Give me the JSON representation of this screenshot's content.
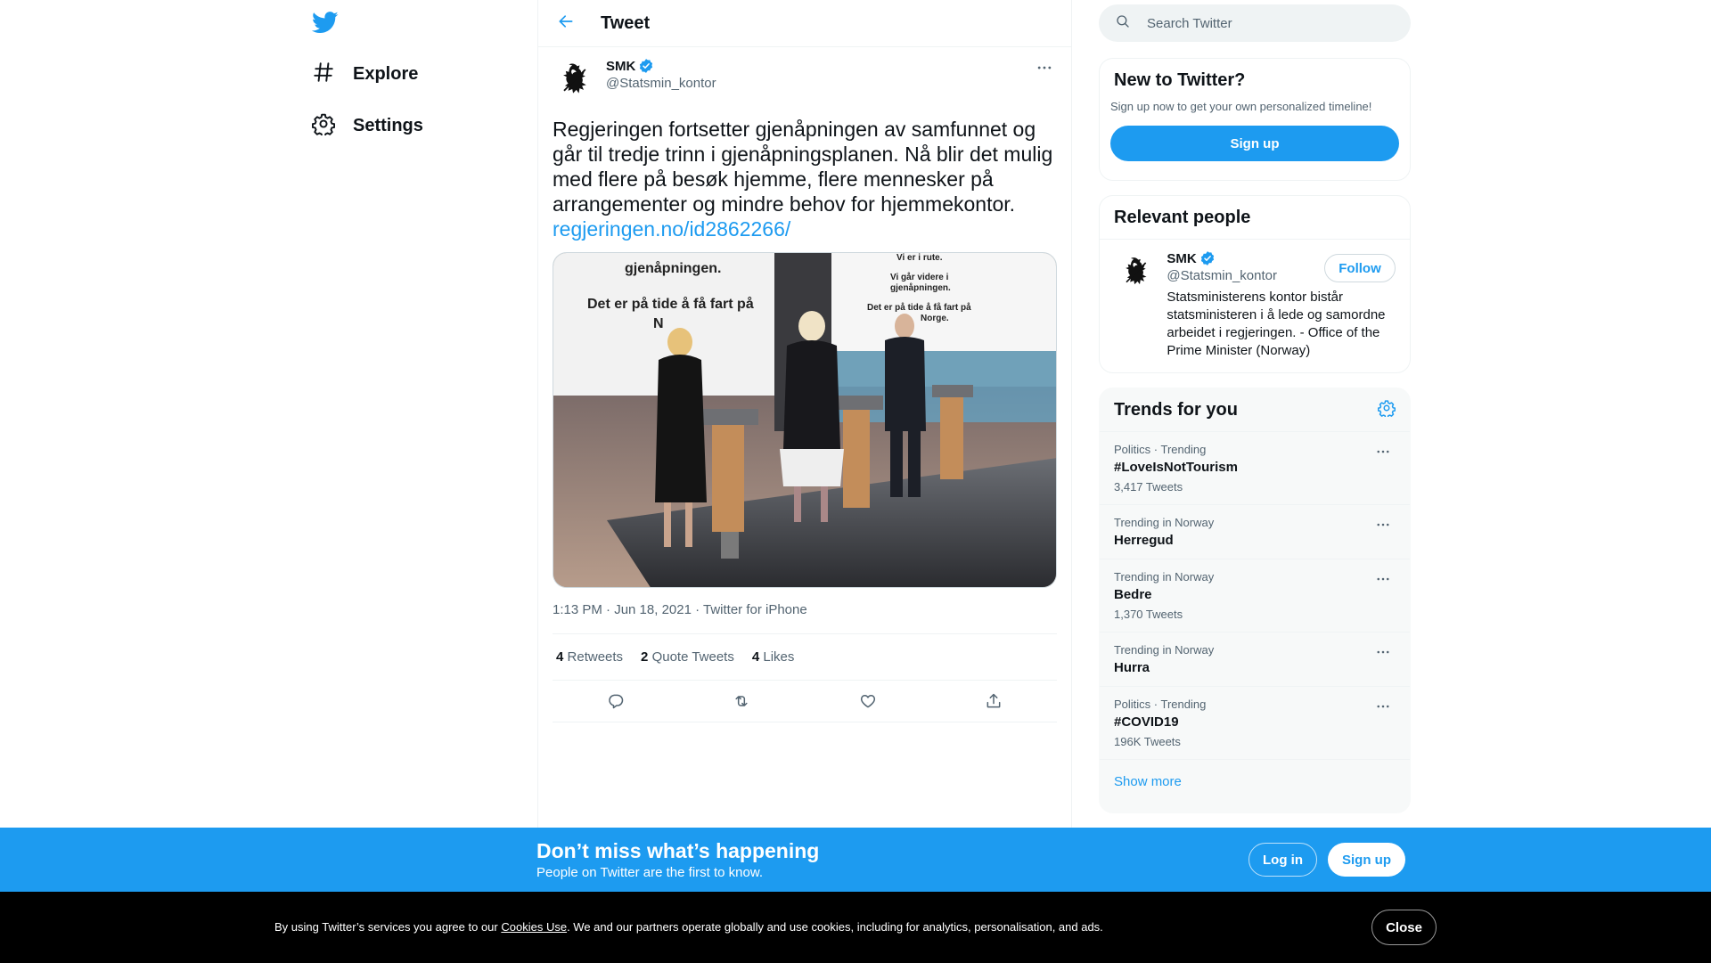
{
  "colors": {
    "accent": "#1d9bf0",
    "text": "#0f1419",
    "muted": "#536471",
    "cookie_bg": "#000000"
  },
  "nav": {
    "logo_icon": "twitter-bird-icon",
    "items": [
      {
        "label": "Explore",
        "icon": "hashtag-icon"
      },
      {
        "label": "Settings",
        "icon": "gear-icon"
      }
    ]
  },
  "header": {
    "title": "Tweet",
    "back_icon": "arrow-left-icon"
  },
  "tweet": {
    "author_name": "SMK",
    "author_handle": "@Statsmin_kontor",
    "text": "Regjeringen fortsetter gjenåpningen av samfunnet og går til tredje trinn i gjenåpningsplanen. Nå blir det mulig med flere på besøk hjemme, flere mennesker på arrangementer og mindre behov for hjemmekontor.",
    "link": "regjeringen.no/id2862266/",
    "media": {
      "screen_left_lines": [
        "gjenåpningen.",
        "Det er på tide å få fart på",
        "N"
      ],
      "screen_right_lines": [
        "Vi er i rute.",
        "Vi går videre i",
        "gjenåpningen.",
        "Det er på tide å få fart på",
        "Norge."
      ]
    },
    "timestamp": "1:13 PM · Jun 18, 2021 · Twitter for iPhone",
    "stats": [
      {
        "num": "4",
        "label": "Retweets"
      },
      {
        "num": "2",
        "label": "Quote Tweets"
      },
      {
        "num": "4",
        "label": "Likes"
      }
    ],
    "actions": [
      "reply-icon",
      "retweet-icon",
      "like-icon",
      "share-icon"
    ]
  },
  "search": {
    "placeholder": "Search Twitter"
  },
  "new_to_twitter": {
    "title": "New to Twitter?",
    "subtitle": "Sign up now to get your own personalized timeline!",
    "button": "Sign up"
  },
  "relevant_people": {
    "title": "Relevant people",
    "person": {
      "name": "SMK",
      "handle": "@Statsmin_kontor",
      "bio": "Statsministerens kontor bistår statsministeren i å lede og samordne arbeidet i regjeringen. - Office of the Prime Minister (Norway)",
      "follow": "Follow"
    }
  },
  "trends": {
    "title": "Trends for you",
    "items": [
      {
        "context": "Politics · Trending",
        "name": "#LoveIsNotTourism",
        "count": "3,417 Tweets"
      },
      {
        "context": "Trending in Norway",
        "name": "Herregud",
        "count": ""
      },
      {
        "context": "Trending in Norway",
        "name": "Bedre",
        "count": "1,370 Tweets"
      },
      {
        "context": "Trending in Norway",
        "name": "Hurra",
        "count": ""
      },
      {
        "context": "Politics · Trending",
        "name": "#COVID19",
        "count": "196K Tweets"
      }
    ],
    "show_more": "Show more"
  },
  "banner": {
    "title": "Don’t miss what’s happening",
    "subtitle": "People on Twitter are the first to know.",
    "login": "Log in",
    "signup": "Sign up"
  },
  "cookies": {
    "text_before": "By using Twitter’s services you agree to our ",
    "link": "Cookies Use",
    "text_after": ". We and our partners operate globally and use cookies, including for analytics, personalisation, and ads.",
    "close": "Close"
  }
}
